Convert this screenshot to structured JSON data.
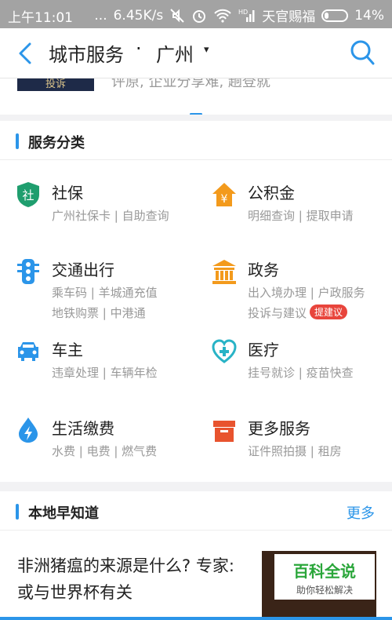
{
  "status": {
    "time": "上午11:01",
    "dots": "...",
    "speed": "6.45K/s",
    "carrier": "天官赐福",
    "signal_label": "HD",
    "battery": "14%"
  },
  "nav": {
    "title": "城市服务",
    "separator": "·",
    "city": "广州",
    "caret": "▾"
  },
  "banner": {
    "badge": "投诉",
    "text": "评原, 企业分享难, 趟登就"
  },
  "services": {
    "title": "服务分类",
    "items": [
      {
        "name": "社保",
        "line1": "广州社保卡 | 自助查询",
        "line2": "",
        "icon_text": "社"
      },
      {
        "name": "公积金",
        "line1": "明细查询 | 提取申请",
        "line2": "",
        "icon_text": "¥"
      },
      {
        "name": "交通出行",
        "line1": "乘车码 | 羊城通充值",
        "line2": "地铁购票 | 中港通"
      },
      {
        "name": "政务",
        "line1": "出入境办理 | 户政服务",
        "line2": "投诉与建议",
        "tag": "提建议"
      },
      {
        "name": "车主",
        "line1": "违章处理 | 车辆年检",
        "line2": ""
      },
      {
        "name": "医疗",
        "line1": "挂号就诊 | 疫苗快查",
        "line2": ""
      },
      {
        "name": "生活缴费",
        "line1": "水费 | 电费 | 燃气费",
        "line2": ""
      },
      {
        "name": "更多服务",
        "line1": "证件照拍摄 | 租房",
        "line2": ""
      }
    ]
  },
  "local": {
    "title": "本地早知道",
    "more": "更多",
    "headline": "非洲猪瘟的来源是什么? 专家: 或与世界杯有关",
    "watermark_title": "百科全说",
    "watermark_sub": "助你轻松解决"
  },
  "colors": {
    "accent": "#2b95e9",
    "green": "#1f9e6e",
    "orange": "#f39a1c",
    "red": "#e8453c",
    "cyan": "#28b3c6"
  }
}
